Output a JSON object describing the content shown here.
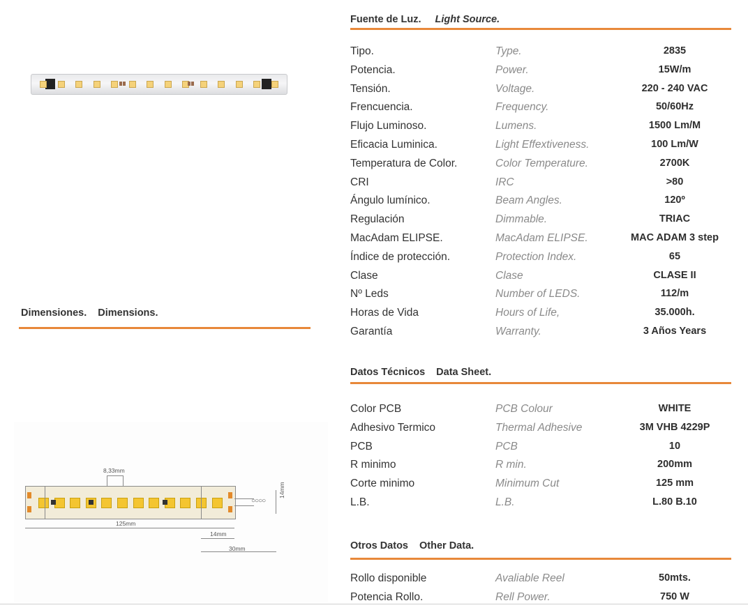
{
  "light_source": {
    "title_es": "Fuente de Luz.",
    "title_en": "Light Source.",
    "rows": [
      {
        "es": "Tipo.",
        "en": "Type.",
        "val": "2835"
      },
      {
        "es": "Potencia.",
        "en": "Power.",
        "val": "15W/m"
      },
      {
        "es": "Tensión.",
        "en": "Voltage.",
        "val": "220 - 240 VAC"
      },
      {
        "es": "Frencuencia.",
        "en": "Frequency.",
        "val": "50/60Hz"
      },
      {
        "es": "Flujo Luminoso.",
        "en": "Lumens.",
        "val": "1500 Lm/M"
      },
      {
        "es": "Eficacia Luminica.",
        "en": "Light Effextiveness.",
        "val": "100 Lm/W"
      },
      {
        "es": "Temperatura de Color.",
        "en": "Color Temperature.",
        "val": "2700K"
      },
      {
        "es": "CRI",
        "en": "IRC",
        "val": ">80"
      },
      {
        "es": "Ángulo lumínico.",
        "en": "Beam Angles.",
        "val": "120º"
      },
      {
        "es": "Regulación",
        "en": "Dimmable.",
        "val": "TRIAC"
      },
      {
        "es": "MacAdam ELIPSE.",
        "en": "MacAdam ELIPSE.",
        "val": "MAC ADAM 3 step"
      },
      {
        "es": "Índice de protección.",
        "en": "Protection Index.",
        "val": "65"
      },
      {
        "es": "Clase",
        "en": "Clase",
        "val": "CLASE II"
      },
      {
        "es": "Nº Leds",
        "en": "Number of LEDS.",
        "val": "112/m"
      },
      {
        "es": "Horas de Vida",
        "en": "Hours of Life,",
        "val": "35.000h."
      },
      {
        "es": "Garantía",
        "en": "Warranty.",
        "val": "3 Años   Years"
      }
    ]
  },
  "data_sheet": {
    "title_es": "Datos Técnicos",
    "title_en": "Data Sheet.",
    "rows": [
      {
        "es": "Color PCB",
        "en": "PCB Colour",
        "val": "WHITE"
      },
      {
        "es": "Adhesivo Termico",
        "en": "Thermal Adhesive",
        "val": "3M VHB 4229P"
      },
      {
        "es": "PCB",
        "en": "PCB",
        "val": "10"
      },
      {
        "es": "R minimo",
        "en": "R min.",
        "val": "200mm"
      },
      {
        "es": "Corte minimo",
        "en": "Minimum Cut",
        "val": "125 mm"
      },
      {
        "es": "L.B.",
        "en": "L.B.",
        "val": "L.80 B.10"
      }
    ]
  },
  "other_data": {
    "title_es": "Otros Datos",
    "title_en": "Other Data.",
    "rows": [
      {
        "es": "Rollo disponible",
        "en": "Avaliable Reel",
        "val": "50mts."
      },
      {
        "es": "Potencia Rollo.",
        "en": "Rell Power.",
        "val": "750 W"
      }
    ]
  },
  "dimensions": {
    "title_es": "Dimensiones.",
    "title_en": "Dimensions.",
    "labels": {
      "pitch": "8,33mm",
      "length": "125mm",
      "end_cap": "14mm",
      "connector": "30mm",
      "height": "14mm"
    }
  },
  "colors": {
    "accent": "#e8883a",
    "led": "#f4c531"
  }
}
